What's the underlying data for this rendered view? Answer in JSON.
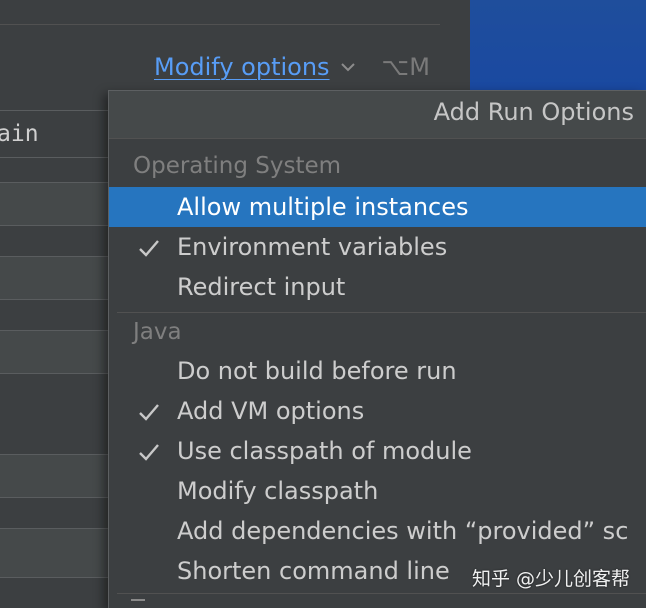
{
  "background": {
    "modify_options_label": "Modify options",
    "modify_options_shortcut": "⌥M",
    "main_field_text": "ain"
  },
  "popup": {
    "title": "Add Run Options",
    "groups": [
      {
        "title": "Operating System",
        "items": [
          {
            "label": "Allow multiple instances",
            "checked": false,
            "selected": true
          },
          {
            "label": "Environment variables",
            "checked": true,
            "selected": false
          },
          {
            "label": "Redirect input",
            "checked": false,
            "selected": false
          }
        ]
      },
      {
        "title": "Java",
        "items": [
          {
            "label": "Do not build before run",
            "checked": false,
            "selected": false
          },
          {
            "label": "Add VM options",
            "checked": true,
            "selected": false
          },
          {
            "label": "Use classpath of module",
            "checked": true,
            "selected": false
          },
          {
            "label": "Modify classpath",
            "checked": false,
            "selected": false
          },
          {
            "label": "Add dependencies with “provided” sc",
            "checked": false,
            "selected": false
          },
          {
            "label": "Shorten command line",
            "checked": false,
            "selected": false
          }
        ]
      }
    ]
  },
  "watermark": "知乎 @少儿创客帮",
  "colors": {
    "selection": "#2675bf",
    "link": "#589df6",
    "background": "#3c3f41"
  },
  "icons": {
    "check": "check-icon",
    "chevron": "chevron-down-icon"
  }
}
